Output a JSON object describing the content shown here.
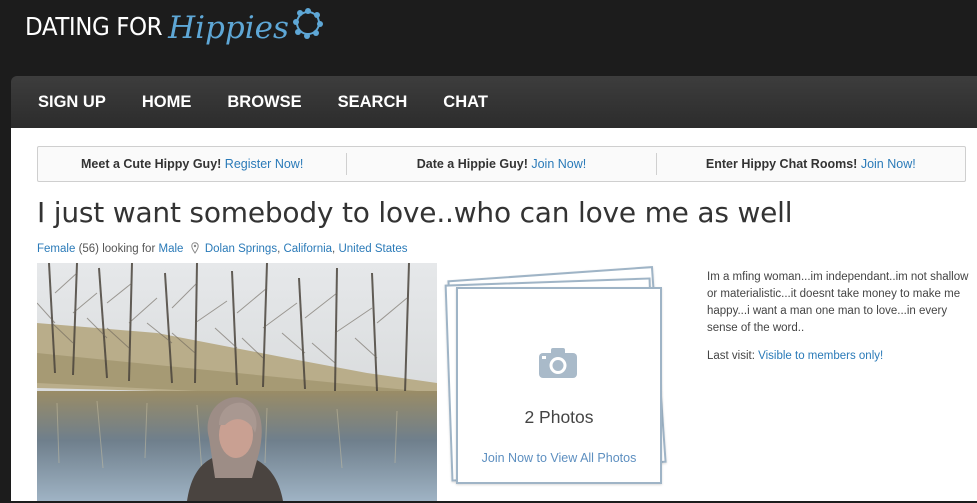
{
  "logo": {
    "part1": "DATING FOR",
    "part2": "Hippies"
  },
  "nav": {
    "items": [
      "SIGN UP",
      "HOME",
      "BROWSE",
      "SEARCH",
      "CHAT"
    ]
  },
  "promos": [
    {
      "text": "Meet a Cute Hippy Guy!",
      "link": "Register Now!"
    },
    {
      "text": "Date a Hippie Guy!",
      "link": "Join Now!"
    },
    {
      "text": "Enter Hippy Chat Rooms!",
      "link": "Join Now!"
    }
  ],
  "profile": {
    "headline": "I just want somebody to love..who can love me as well",
    "gender": "Female",
    "age": "(56)",
    "looking_for_label": "looking for",
    "seeking": "Male",
    "city": "Dolan Springs",
    "state": "California",
    "country": "United States",
    "sep": ",",
    "bio": "Im a mfing woman...im independant..im not shallow or materialistic...it doesnt take money to make me happy...i want a man one man to love...in every sense of the word..",
    "last_visit_label": "Last visit:",
    "last_visit_value": "Visible to members only!"
  },
  "photos": {
    "count_text": "2 Photos",
    "join_text": "Join Now to View All Photos"
  },
  "colors": {
    "accent": "#2a7ab8",
    "nav_bg": "#333333",
    "logo_blue": "#5ea7d6"
  }
}
